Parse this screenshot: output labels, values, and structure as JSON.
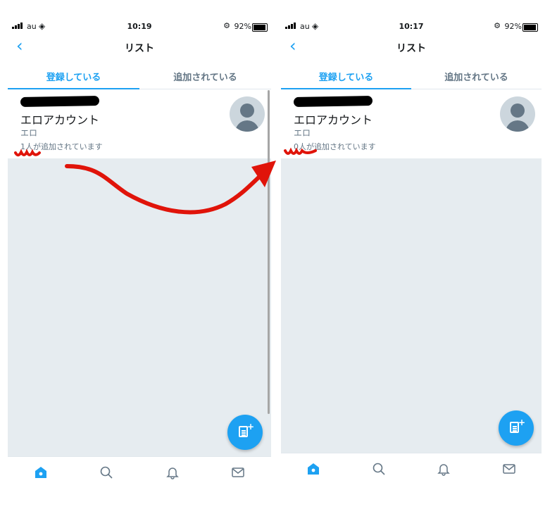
{
  "screens": [
    {
      "status": {
        "carrier": "au",
        "time": "10:19",
        "battery": "92%"
      },
      "nav_title": "リスト",
      "tabs": [
        "登録している",
        "追加されている"
      ],
      "list": {
        "name": "エロアカウント",
        "description": "エロ",
        "members": "1人が追加されています"
      }
    },
    {
      "status": {
        "carrier": "au",
        "time": "10:17",
        "battery": "92%"
      },
      "nav_title": "リスト",
      "tabs": [
        "登録している",
        "追加されている"
      ],
      "list": {
        "name": "エロアカウント",
        "description": "エロ",
        "members": "0人が追加されています"
      }
    }
  ],
  "icons": {
    "back": "chevron-left-icon",
    "fab": "new-list-icon",
    "tabbar": [
      "home-icon",
      "search-icon",
      "bell-icon",
      "mail-icon"
    ]
  },
  "colors": {
    "accent": "#1da1f2",
    "annotation": "#e0140a",
    "empty_bg": "#e6ecf0"
  }
}
